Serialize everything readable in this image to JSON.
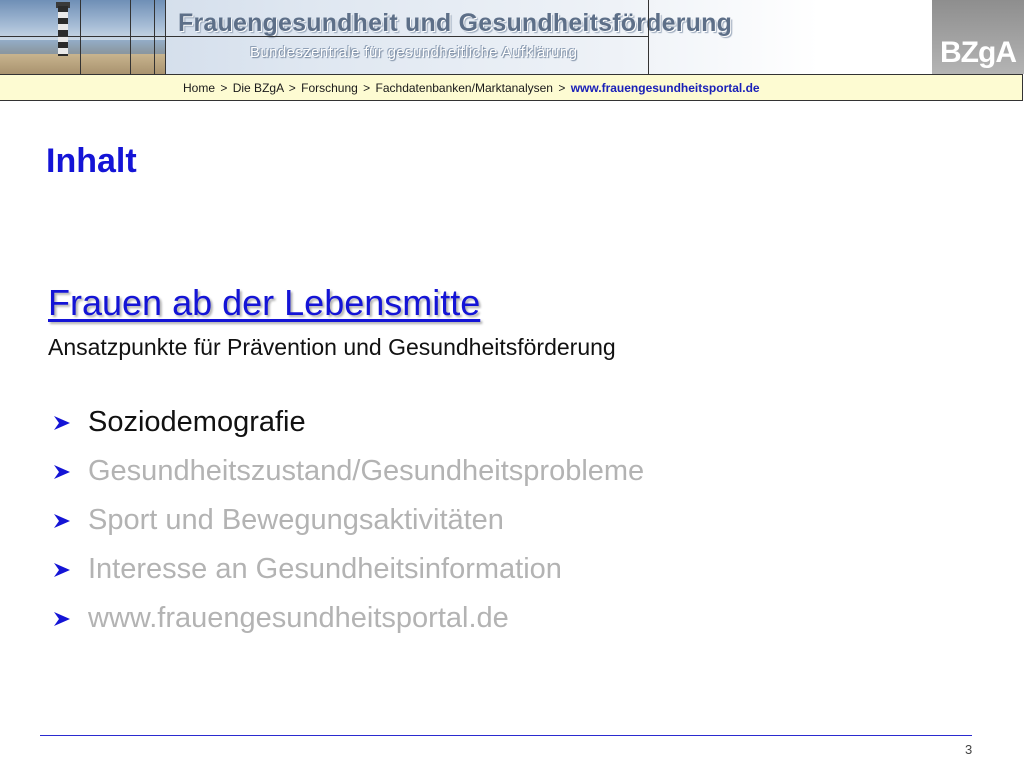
{
  "header": {
    "title": "Frauengesundheit und Gesundheitsförderung",
    "subtitle": "Bundeszentrale für gesundheitliche Aufklärung",
    "logo": "BZgA"
  },
  "breadcrumb": {
    "items": [
      "Home",
      "Die BZgA",
      "Forschung",
      "Fachdatenbanken/Marktanalysen"
    ],
    "separator": ">",
    "current_url": "www.frauengesundheitsportal.de"
  },
  "content": {
    "heading": "Inhalt",
    "topic_title": "Frauen ab der Lebensmitte",
    "topic_subtitle": "Ansatzpunkte für Prävention und Gesundheitsförderung",
    "bullets": [
      {
        "label": "Soziodemografie",
        "active": true
      },
      {
        "label": "Gesundheitszustand/Gesundheitsprobleme",
        "active": false
      },
      {
        "label": "Sport und Bewegungsaktivitäten",
        "active": false
      },
      {
        "label": "Interesse an Gesundheitsinformation",
        "active": false
      },
      {
        "label": "www.frauengesundheitsportal.de",
        "active": false
      }
    ]
  },
  "footer": {
    "page_number": "3"
  },
  "colors": {
    "accent_blue": "#1414d6",
    "breadcrumb_bg": "#fdfbd2",
    "inactive_text": "#b3b3b3",
    "bullet_arrow": "#1414d6"
  },
  "icons": {
    "bullet": "arrow-bullet-icon",
    "banner_photo": "lighthouse-photo"
  }
}
